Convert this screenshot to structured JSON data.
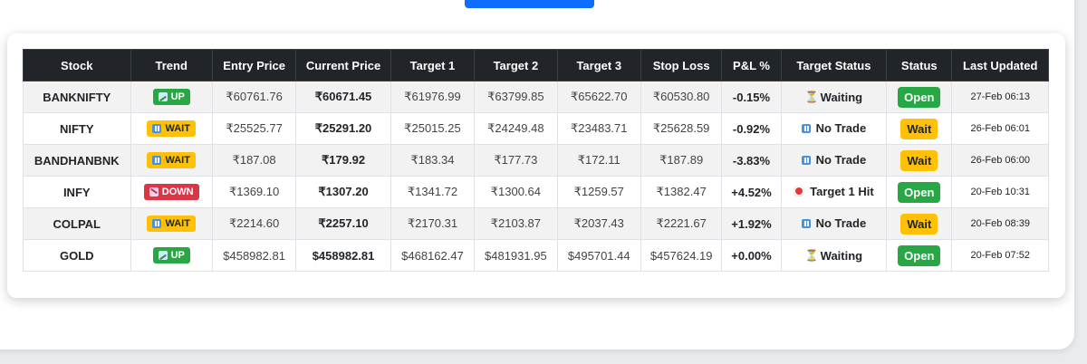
{
  "table": {
    "headers": [
      "Stock",
      "Trend",
      "Entry Price",
      "Current Price",
      "Target 1",
      "Target 2",
      "Target 3",
      "Stop Loss",
      "P&L %",
      "Target Status",
      "Status",
      "Last Updated"
    ],
    "rows": [
      {
        "stock": "BANKNIFTY",
        "trend": "UP",
        "trend_type": "up",
        "entry": "₹60761.76",
        "current": "₹60671.45",
        "t1": "₹61976.99",
        "t2": "₹63799.85",
        "t3": "₹65622.70",
        "sl": "₹60530.80",
        "pnl": "-0.15%",
        "target_status": "Waiting",
        "target_icon": "hourglass-icon",
        "status": "Open",
        "updated": "27-Feb 06:13"
      },
      {
        "stock": "NIFTY",
        "trend": "WAIT",
        "trend_type": "wait",
        "entry": "₹25525.77",
        "current": "₹25291.20",
        "t1": "₹25015.25",
        "t2": "₹24249.48",
        "t3": "₹23483.71",
        "sl": "₹25628.59",
        "pnl": "-0.92%",
        "target_status": "No Trade",
        "target_icon": "pause-icon",
        "status": "Wait",
        "updated": "26-Feb 06:01"
      },
      {
        "stock": "BANDHANBNK",
        "trend": "WAIT",
        "trend_type": "wait",
        "entry": "₹187.08",
        "current": "₹179.92",
        "t1": "₹183.34",
        "t2": "₹177.73",
        "t3": "₹172.11",
        "sl": "₹187.89",
        "pnl": "-3.83%",
        "target_status": "No Trade",
        "target_icon": "pause-icon",
        "status": "Wait",
        "updated": "26-Feb 06:00"
      },
      {
        "stock": "INFY",
        "trend": "DOWN",
        "trend_type": "down",
        "entry": "₹1369.10",
        "current": "₹1307.20",
        "t1": "₹1341.72",
        "t2": "₹1300.64",
        "t3": "₹1259.57",
        "sl": "₹1382.47",
        "pnl": "+4.52%",
        "target_status": "Target 1 Hit",
        "target_icon": "target-icon",
        "status": "Open",
        "updated": "20-Feb 10:31"
      },
      {
        "stock": "COLPAL",
        "trend": "WAIT",
        "trend_type": "wait",
        "entry": "₹2214.60",
        "current": "₹2257.10",
        "t1": "₹2170.31",
        "t2": "₹2103.87",
        "t3": "₹2037.43",
        "sl": "₹2221.67",
        "pnl": "+1.92%",
        "target_status": "No Trade",
        "target_icon": "pause-icon",
        "status": "Wait",
        "updated": "20-Feb 08:39"
      },
      {
        "stock": "GOLD",
        "trend": "UP",
        "trend_type": "up",
        "entry": "$458982.81",
        "current": "$458982.81",
        "t1": "$468162.47",
        "t2": "$481931.95",
        "t3": "$495701.44",
        "sl": "$457624.19",
        "pnl": "+0.00%",
        "target_status": "Waiting",
        "target_icon": "hourglass-icon",
        "status": "Open",
        "updated": "20-Feb 07:52"
      }
    ]
  },
  "colors": {
    "header_bg": "#212529",
    "up": "#28a745",
    "wait": "#ffc107",
    "down": "#dc3545",
    "primary": "#0d6efd"
  }
}
